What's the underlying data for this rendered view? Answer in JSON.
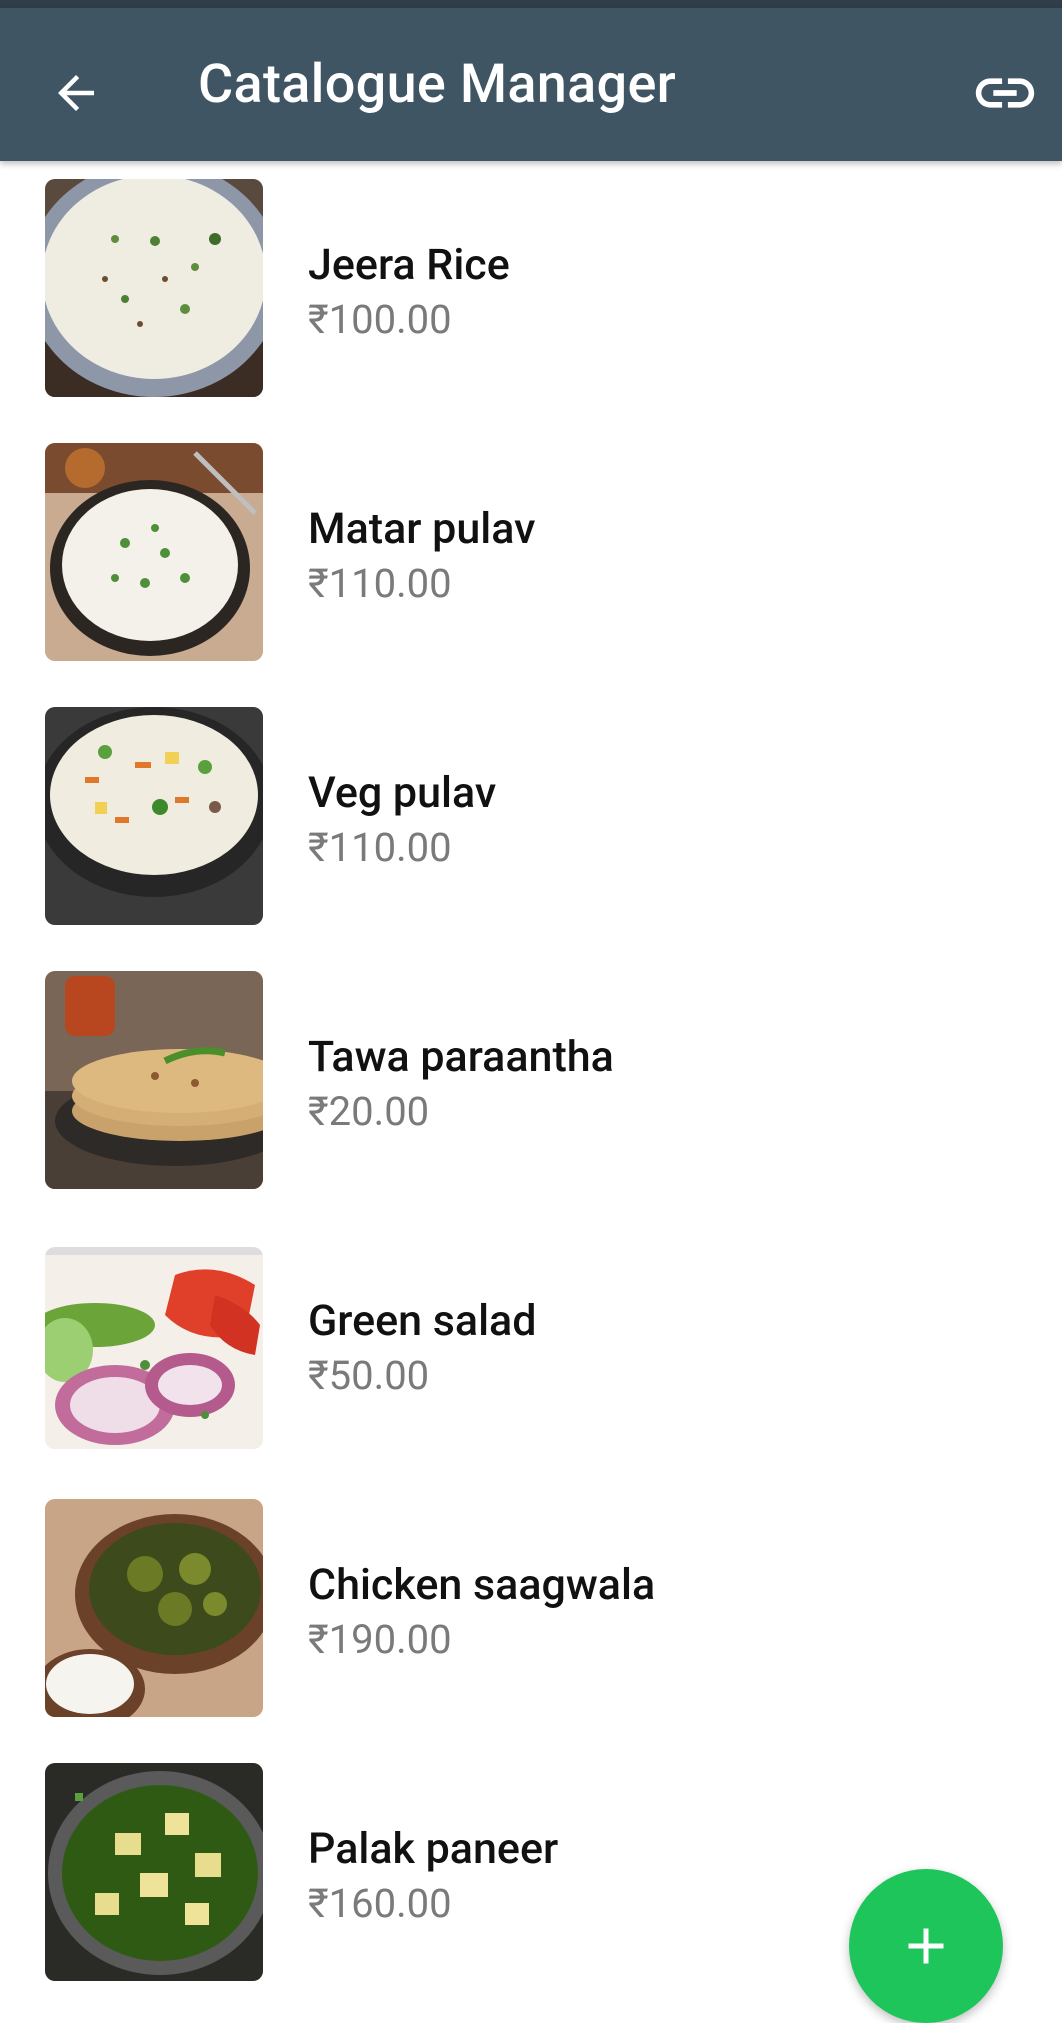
{
  "appbar": {
    "title": "Catalogue Manager",
    "back_icon": "arrow-left-icon",
    "link_icon": "link-icon",
    "background": "#3f5564"
  },
  "products": [
    {
      "name": "Jeera Rice",
      "price": "₹100.00",
      "image": "jeera-rice-photo"
    },
    {
      "name": "Matar pulav",
      "price": "₹110.00",
      "image": "matar-pulav-photo"
    },
    {
      "name": "Veg pulav",
      "price": "₹110.00",
      "image": "veg-pulav-photo"
    },
    {
      "name": "Tawa paraantha",
      "price": "₹20.00",
      "image": "tawa-paratha-photo"
    },
    {
      "name": "Green salad",
      "price": "₹50.00",
      "image": "green-salad-photo"
    },
    {
      "name": "Chicken saagwala",
      "price": "₹190.00",
      "image": "chicken-saagwala-photo"
    },
    {
      "name": "Palak paneer",
      "price": "₹160.00",
      "image": "palak-paneer-photo"
    }
  ],
  "fab": {
    "icon": "plus-icon",
    "color": "#1ec55a"
  }
}
